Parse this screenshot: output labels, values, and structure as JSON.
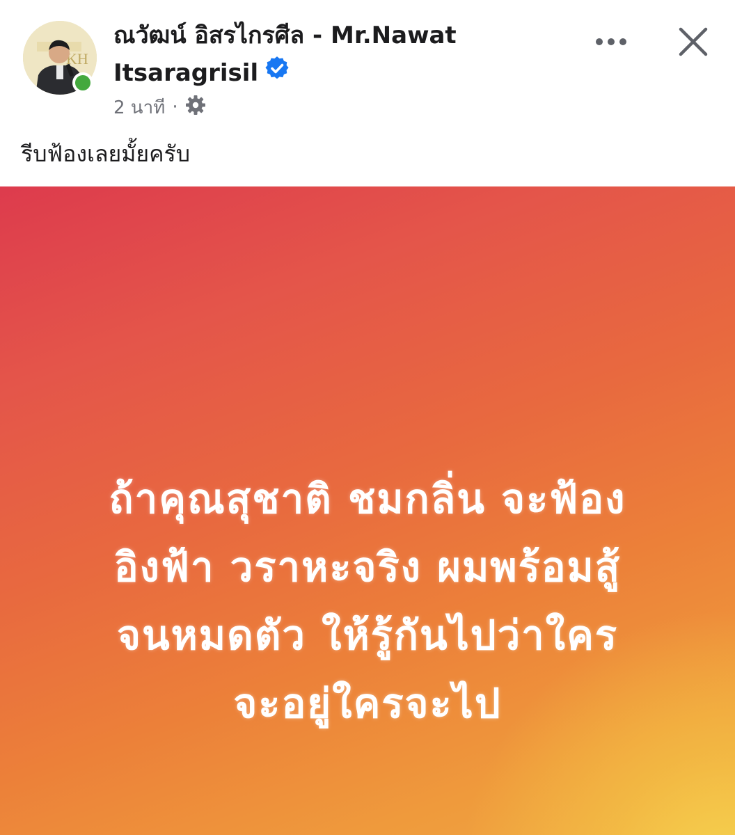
{
  "post": {
    "author_line1": "ณวัฒน์ อิสรไกรศีล - Mr.Nawat",
    "author_line2": "Itsaragrisil",
    "time": "2 นาที",
    "separator": "·",
    "caption": "รีบฟ้องเลยมั้ยครับ",
    "icons": {
      "verified": "verified-badge-icon",
      "audience": "gear-icon",
      "more": "more-horizontal-icon",
      "close": "close-icon",
      "online": "online-status-dot"
    },
    "colors": {
      "verified": "#1877f2",
      "online": "#44a93e",
      "gradient_top": "#dd3b4d",
      "gradient_bottom": "#f0a843",
      "gradient_glow": "#f5d750"
    }
  },
  "media": {
    "lines": [
      "ถ้าคุณสุชาติ ชมกลิ่น จะฟ้อง",
      "อิงฟ้า วราหะจริง ผมพร้อมสู้",
      "จนหมดตัว ให้รู้กันไปว่าใคร",
      "จะอยู่ใครจะไป"
    ]
  }
}
